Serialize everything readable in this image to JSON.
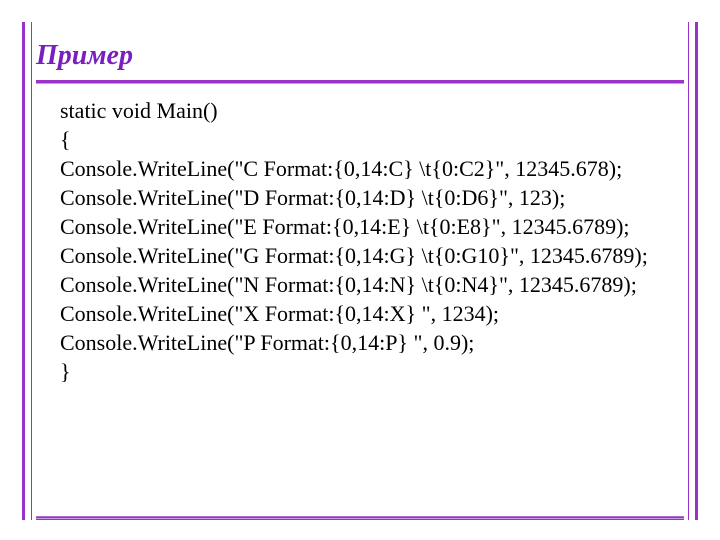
{
  "title": "Пример",
  "code_lines": [
    "static void Main()",
    "{",
    "Console.WriteLine(\"C Format:{0,14:C} \\t{0:C2}\", 12345.678);",
    "Console.WriteLine(\"D Format:{0,14:D} \\t{0:D6}\", 123);",
    "Console.WriteLine(\"E Format:{0,14:E} \\t{0:E8}\", 12345.6789);",
    "Console.WriteLine(\"G Format:{0,14:G} \\t{0:G10}\", 12345.6789);",
    "Console.WriteLine(\"N Format:{0,14:N} \\t{0:N4}\", 12345.6789);",
    "Console.WriteLine(\"X Format:{0,14:X} \", 1234);",
    "Console.WriteLine(\"P Format:{0,14:P} \", 0.9);",
    "}"
  ]
}
